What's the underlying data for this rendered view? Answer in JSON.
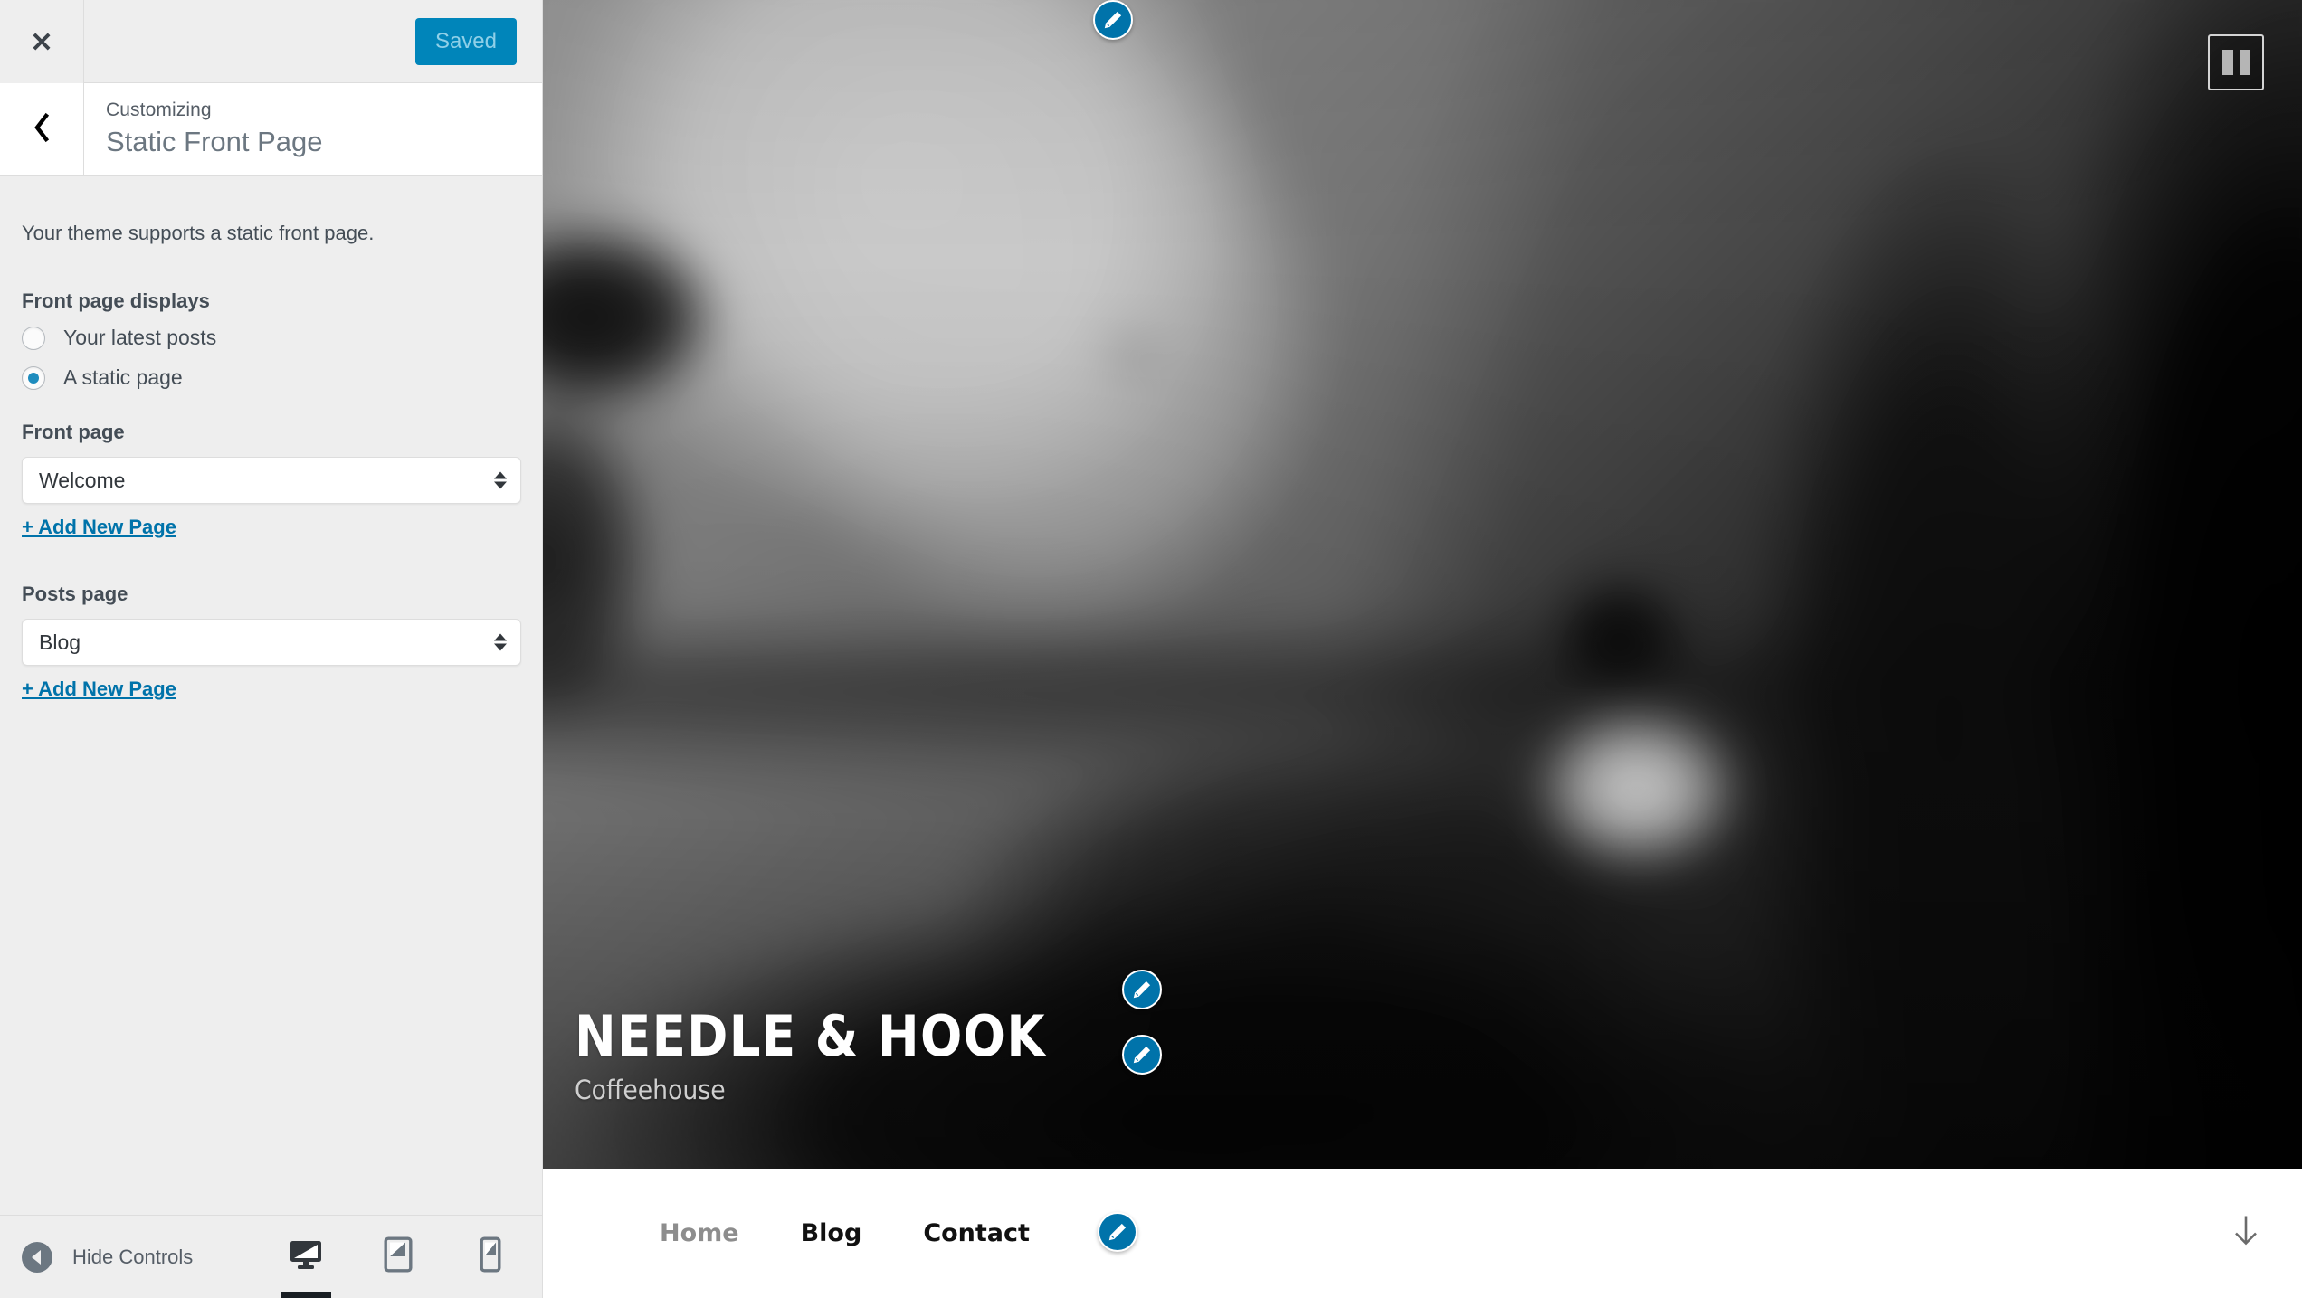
{
  "customizer": {
    "close_icon": "close-icon",
    "save_button_label": "Saved",
    "back_icon": "chevron-left-icon",
    "pretitle": "Customizing",
    "title": "Static Front Page",
    "notice": "Your theme supports a static front page.",
    "front_page_displays": {
      "label": "Front page displays",
      "options": [
        {
          "label": "Your latest posts",
          "selected": false
        },
        {
          "label": "A static page",
          "selected": true
        }
      ]
    },
    "front_page": {
      "label": "Front page",
      "value": "Welcome",
      "add_new_label": "+ Add New Page"
    },
    "posts_page": {
      "label": "Posts page",
      "value": "Blog",
      "add_new_label": "+ Add New Page"
    },
    "footer": {
      "collapse_label": "Hide Controls",
      "collapse_icon": "collapse-left-icon",
      "devices": [
        {
          "name": "desktop",
          "icon": "desktop-icon",
          "active": true
        },
        {
          "name": "tablet",
          "icon": "tablet-icon",
          "active": false
        },
        {
          "name": "mobile",
          "icon": "mobile-icon",
          "active": false
        }
      ]
    },
    "accent_color": "#0085ba",
    "link_color": "#0073aa",
    "radio_checked_color": "#1e8cbe"
  },
  "preview": {
    "edit_shortcut_icon": "pencil-icon",
    "pause_button": {
      "label": "pause-icon",
      "state": "playing"
    },
    "site_title": "NEEDLE & HOOK",
    "site_tagline": "Coffeehouse",
    "nav": {
      "items": [
        {
          "label": "Home",
          "current": true
        },
        {
          "label": "Blog",
          "current": false
        },
        {
          "label": "Contact",
          "current": false
        }
      ]
    },
    "scroll_down_icon": "arrow-down-icon"
  }
}
